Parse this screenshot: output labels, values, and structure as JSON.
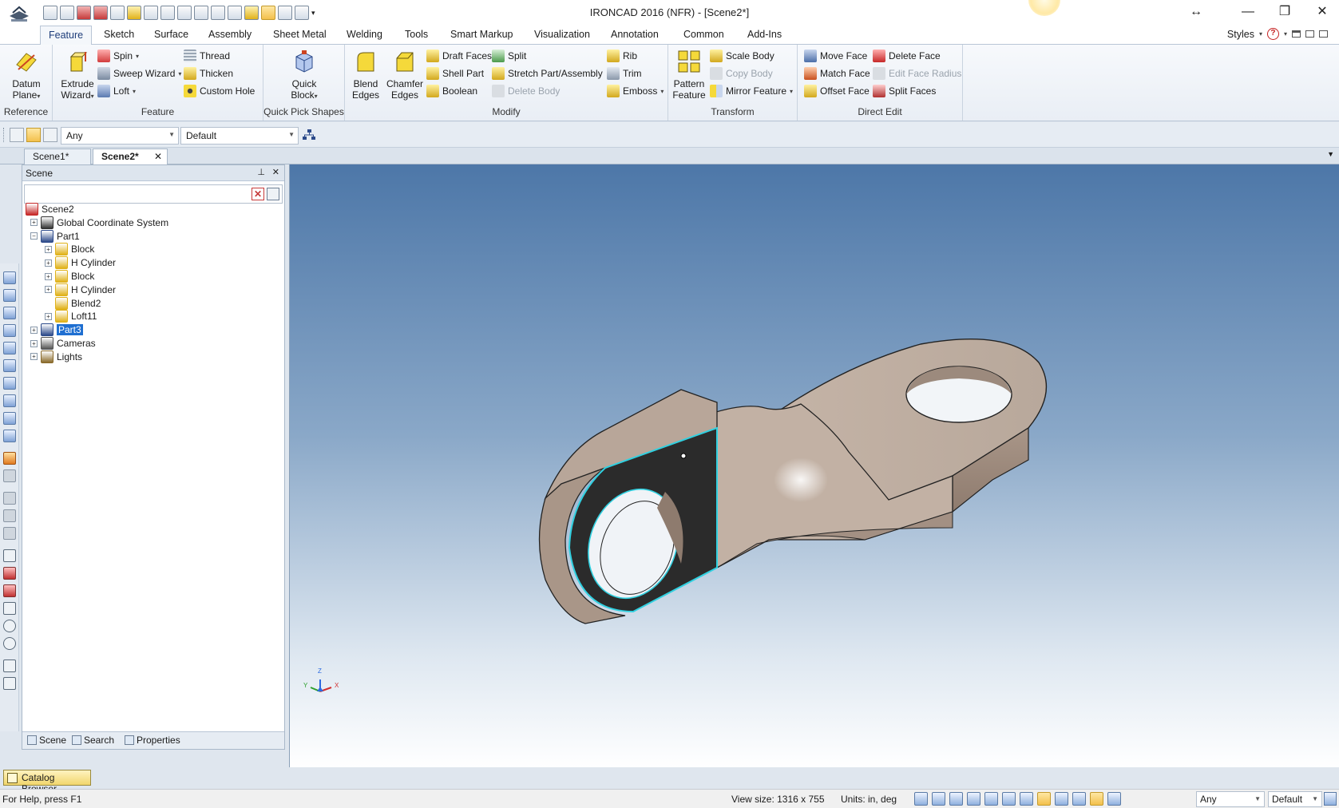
{
  "window": {
    "title": "IRONCAD 2016 (NFR) - [Scene2*]",
    "restore_glyph": "↔",
    "min_glyph": "—",
    "max_glyph": "❐",
    "close_glyph": "✕"
  },
  "ribbon_tabs": [
    "Feature",
    "Sketch",
    "Surface",
    "Assembly",
    "Sheet Metal",
    "Welding",
    "Tools",
    "Smart Markup",
    "Visualization",
    "Annotation",
    "Common",
    "Add-Ins"
  ],
  "styles_label": "Styles",
  "help_glyph": "?",
  "groups": {
    "reference": "Reference",
    "feature": "Feature",
    "quick_pick": "Quick Pick Shapes",
    "modify": "Modify",
    "transform": "Transform",
    "direct_edit": "Direct Edit"
  },
  "buttons": {
    "datum_plane_1": "Datum",
    "datum_plane_2": "Plane",
    "extrude_1": "Extrude",
    "extrude_2": "Wizard",
    "spin": "Spin",
    "sweep": "Sweep Wizard",
    "loft": "Loft",
    "thread": "Thread",
    "thicken": "Thicken",
    "custom_hole": "Custom Hole",
    "quick_block_1": "Quick",
    "quick_block_2": "Block",
    "blend_1": "Blend",
    "blend_2": "Edges",
    "chamfer_1": "Chamfer",
    "chamfer_2": "Edges",
    "draft_faces": "Draft Faces",
    "shell_part": "Shell Part",
    "boolean": "Boolean",
    "split": "Split",
    "stretch": "Stretch Part/Assembly",
    "delete_body": "Delete Body",
    "rib": "Rib",
    "trim": "Trim",
    "emboss": "Emboss",
    "pattern_1": "Pattern",
    "pattern_2": "Feature",
    "scale_body": "Scale Body",
    "copy_body": "Copy Body",
    "mirror_feature": "Mirror Feature",
    "move_face": "Move Face",
    "match_face": "Match Face",
    "offset_face": "Offset Face",
    "delete_face": "Delete Face",
    "edit_face_radius": "Edit Face Radius",
    "split_faces": "Split Faces"
  },
  "filterbar": {
    "select_filter": "Any",
    "style_filter": "Default"
  },
  "doc_tabs": [
    "Scene1*",
    "Scene2*"
  ],
  "scene_panel": {
    "title": "Scene",
    "pin_glyph": "⊥",
    "close_glyph": "✕",
    "footer_tabs": [
      "Scene",
      "Search",
      "Properties"
    ]
  },
  "tree": [
    {
      "label": "Scene2",
      "level": 0
    },
    {
      "label": "Global Coordinate System",
      "level": 1
    },
    {
      "label": "Part1",
      "level": 1
    },
    {
      "label": "Block",
      "level": 2
    },
    {
      "label": "H Cylinder",
      "level": 2
    },
    {
      "label": "Block",
      "level": 2
    },
    {
      "label": "H Cylinder",
      "level": 2
    },
    {
      "label": "Blend2",
      "level": 2
    },
    {
      "label": "Loft11",
      "level": 2
    },
    {
      "label": "Part3",
      "level": 1,
      "selected": true
    },
    {
      "label": "Cameras",
      "level": 1
    },
    {
      "label": "Lights",
      "level": 1
    }
  ],
  "catalog_browser": "Catalog Browser",
  "axes": {
    "x": "X",
    "y": "Y",
    "z": "Z"
  },
  "status": {
    "help": "For Help, press F1",
    "view_size": "View size: 1316 x 755",
    "units": "Units: in, deg",
    "filter": "Any",
    "style": "Default"
  },
  "colors": {
    "part_fill": "#c8b9ad",
    "selected_face": "#2a2a2a",
    "selection_edge": "#30d0e0",
    "ribbon_active_tab": "#1e3d7a"
  }
}
